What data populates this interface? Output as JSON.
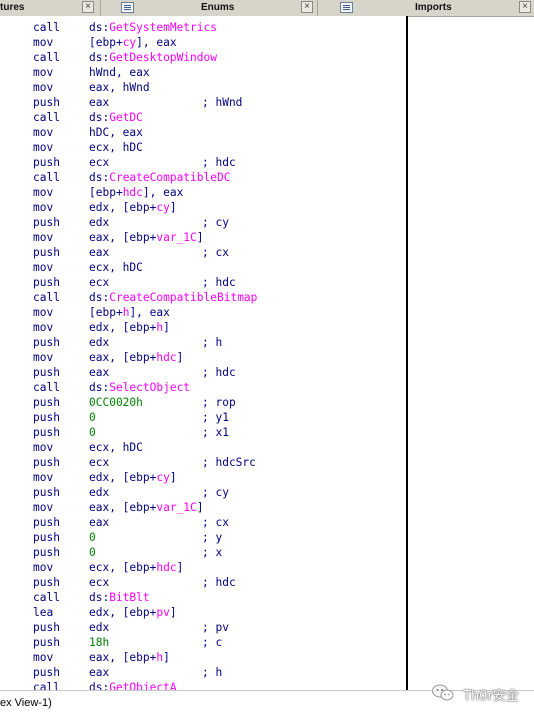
{
  "tabs": [
    {
      "label": "tures"
    },
    {
      "label": "Enums"
    },
    {
      "label": "Imports"
    }
  ],
  "lines": [
    {
      "mnemonic": "call",
      "operand": [
        {
          "t": "ds:",
          "c": "reg"
        },
        {
          "t": "GetSystemMetrics",
          "c": "imp"
        }
      ],
      "comment": ""
    },
    {
      "mnemonic": "mov",
      "operand": [
        {
          "t": "[ebp+",
          "c": "reg"
        },
        {
          "t": "cy",
          "c": "imp"
        },
        {
          "t": "], eax",
          "c": "reg"
        }
      ],
      "comment": ""
    },
    {
      "mnemonic": "call",
      "operand": [
        {
          "t": "ds:",
          "c": "reg"
        },
        {
          "t": "GetDesktopWindow",
          "c": "imp"
        }
      ],
      "comment": ""
    },
    {
      "mnemonic": "mov",
      "operand": [
        {
          "t": "hWnd, eax",
          "c": "reg"
        }
      ],
      "comment": ""
    },
    {
      "mnemonic": "mov",
      "operand": [
        {
          "t": "eax, hWnd",
          "c": "reg"
        }
      ],
      "comment": ""
    },
    {
      "mnemonic": "push",
      "operand": [
        {
          "t": "eax",
          "c": "reg"
        }
      ],
      "comment": "; hWnd"
    },
    {
      "mnemonic": "call",
      "operand": [
        {
          "t": "ds:",
          "c": "reg"
        },
        {
          "t": "GetDC",
          "c": "imp"
        }
      ],
      "comment": ""
    },
    {
      "mnemonic": "mov",
      "operand": [
        {
          "t": "hDC, eax",
          "c": "reg"
        }
      ],
      "comment": ""
    },
    {
      "mnemonic": "mov",
      "operand": [
        {
          "t": "ecx, hDC",
          "c": "reg"
        }
      ],
      "comment": ""
    },
    {
      "mnemonic": "push",
      "operand": [
        {
          "t": "ecx",
          "c": "reg"
        }
      ],
      "comment": "; hdc"
    },
    {
      "mnemonic": "call",
      "operand": [
        {
          "t": "ds:",
          "c": "reg"
        },
        {
          "t": "CreateCompatibleDC",
          "c": "imp"
        }
      ],
      "comment": ""
    },
    {
      "mnemonic": "mov",
      "operand": [
        {
          "t": "[ebp+",
          "c": "reg"
        },
        {
          "t": "hdc",
          "c": "imp"
        },
        {
          "t": "], eax",
          "c": "reg"
        }
      ],
      "comment": ""
    },
    {
      "mnemonic": "mov",
      "operand": [
        {
          "t": "edx, [ebp+",
          "c": "reg"
        },
        {
          "t": "cy",
          "c": "imp"
        },
        {
          "t": "]",
          "c": "reg"
        }
      ],
      "comment": ""
    },
    {
      "mnemonic": "push",
      "operand": [
        {
          "t": "edx",
          "c": "reg"
        }
      ],
      "comment": "; cy"
    },
    {
      "mnemonic": "mov",
      "operand": [
        {
          "t": "eax, [ebp+",
          "c": "reg"
        },
        {
          "t": "var_1C",
          "c": "imp"
        },
        {
          "t": "]",
          "c": "reg"
        }
      ],
      "comment": ""
    },
    {
      "mnemonic": "push",
      "operand": [
        {
          "t": "eax",
          "c": "reg"
        }
      ],
      "comment": "; cx"
    },
    {
      "mnemonic": "mov",
      "operand": [
        {
          "t": "ecx, hDC",
          "c": "reg"
        }
      ],
      "comment": ""
    },
    {
      "mnemonic": "push",
      "operand": [
        {
          "t": "ecx",
          "c": "reg"
        }
      ],
      "comment": "; hdc"
    },
    {
      "mnemonic": "call",
      "operand": [
        {
          "t": "ds:",
          "c": "reg"
        },
        {
          "t": "CreateCompatibleBitmap",
          "c": "imp"
        }
      ],
      "comment": ""
    },
    {
      "mnemonic": "mov",
      "operand": [
        {
          "t": "[ebp+",
          "c": "reg"
        },
        {
          "t": "h",
          "c": "imp"
        },
        {
          "t": "], eax",
          "c": "reg"
        }
      ],
      "comment": ""
    },
    {
      "mnemonic": "mov",
      "operand": [
        {
          "t": "edx, [ebp+",
          "c": "reg"
        },
        {
          "t": "h",
          "c": "imp"
        },
        {
          "t": "]",
          "c": "reg"
        }
      ],
      "comment": ""
    },
    {
      "mnemonic": "push",
      "operand": [
        {
          "t": "edx",
          "c": "reg"
        }
      ],
      "comment": "; h"
    },
    {
      "mnemonic": "mov",
      "operand": [
        {
          "t": "eax, [ebp+",
          "c": "reg"
        },
        {
          "t": "hdc",
          "c": "imp"
        },
        {
          "t": "]",
          "c": "reg"
        }
      ],
      "comment": ""
    },
    {
      "mnemonic": "push",
      "operand": [
        {
          "t": "eax",
          "c": "reg"
        }
      ],
      "comment": "; hdc"
    },
    {
      "mnemonic": "call",
      "operand": [
        {
          "t": "ds:",
          "c": "reg"
        },
        {
          "t": "SelectObject",
          "c": "imp"
        }
      ],
      "comment": ""
    },
    {
      "mnemonic": "push",
      "operand": [
        {
          "t": "0CC0020h",
          "c": "num"
        }
      ],
      "comment": "; rop"
    },
    {
      "mnemonic": "push",
      "operand": [
        {
          "t": "0",
          "c": "num"
        }
      ],
      "comment": "; y1"
    },
    {
      "mnemonic": "push",
      "operand": [
        {
          "t": "0",
          "c": "num"
        }
      ],
      "comment": "; x1"
    },
    {
      "mnemonic": "mov",
      "operand": [
        {
          "t": "ecx, hDC",
          "c": "reg"
        }
      ],
      "comment": ""
    },
    {
      "mnemonic": "push",
      "operand": [
        {
          "t": "ecx",
          "c": "reg"
        }
      ],
      "comment": "; hdcSrc"
    },
    {
      "mnemonic": "mov",
      "operand": [
        {
          "t": "edx, [ebp+",
          "c": "reg"
        },
        {
          "t": "cy",
          "c": "imp"
        },
        {
          "t": "]",
          "c": "reg"
        }
      ],
      "comment": ""
    },
    {
      "mnemonic": "push",
      "operand": [
        {
          "t": "edx",
          "c": "reg"
        }
      ],
      "comment": "; cy"
    },
    {
      "mnemonic": "mov",
      "operand": [
        {
          "t": "eax, [ebp+",
          "c": "reg"
        },
        {
          "t": "var_1C",
          "c": "imp"
        },
        {
          "t": "]",
          "c": "reg"
        }
      ],
      "comment": ""
    },
    {
      "mnemonic": "push",
      "operand": [
        {
          "t": "eax",
          "c": "reg"
        }
      ],
      "comment": "; cx"
    },
    {
      "mnemonic": "push",
      "operand": [
        {
          "t": "0",
          "c": "num"
        }
      ],
      "comment": "; y"
    },
    {
      "mnemonic": "push",
      "operand": [
        {
          "t": "0",
          "c": "num"
        }
      ],
      "comment": "; x"
    },
    {
      "mnemonic": "mov",
      "operand": [
        {
          "t": "ecx, [ebp+",
          "c": "reg"
        },
        {
          "t": "hdc",
          "c": "imp"
        },
        {
          "t": "]",
          "c": "reg"
        }
      ],
      "comment": ""
    },
    {
      "mnemonic": "push",
      "operand": [
        {
          "t": "ecx",
          "c": "reg"
        }
      ],
      "comment": "; hdc"
    },
    {
      "mnemonic": "call",
      "operand": [
        {
          "t": "ds:",
          "c": "reg"
        },
        {
          "t": "BitBlt",
          "c": "imp"
        }
      ],
      "comment": ""
    },
    {
      "mnemonic": "lea",
      "operand": [
        {
          "t": "edx, [ebp+",
          "c": "reg"
        },
        {
          "t": "pv",
          "c": "imp"
        },
        {
          "t": "]",
          "c": "reg"
        }
      ],
      "comment": ""
    },
    {
      "mnemonic": "push",
      "operand": [
        {
          "t": "edx",
          "c": "reg"
        }
      ],
      "comment": "; pv"
    },
    {
      "mnemonic": "push",
      "operand": [
        {
          "t": "18h",
          "c": "num"
        }
      ],
      "comment": "; c"
    },
    {
      "mnemonic": "mov",
      "operand": [
        {
          "t": "eax, [ebp+",
          "c": "reg"
        },
        {
          "t": "h",
          "c": "imp"
        },
        {
          "t": "]",
          "c": "reg"
        }
      ],
      "comment": ""
    },
    {
      "mnemonic": "push",
      "operand": [
        {
          "t": "eax",
          "c": "reg"
        }
      ],
      "comment": "; h"
    },
    {
      "mnemonic": "call",
      "operand": [
        {
          "t": "ds:",
          "c": "reg"
        },
        {
          "t": "GetObjectA",
          "c": "imp"
        }
      ],
      "comment": ""
    }
  ],
  "status": {
    "left": "ex View-1)"
  },
  "watermark": {
    "text": "Th0r安全",
    "logo_icon": "wechat-icon"
  },
  "colors": {
    "mnemonic": "#000080",
    "import_name": "#ff00ff",
    "number": "#008000"
  }
}
